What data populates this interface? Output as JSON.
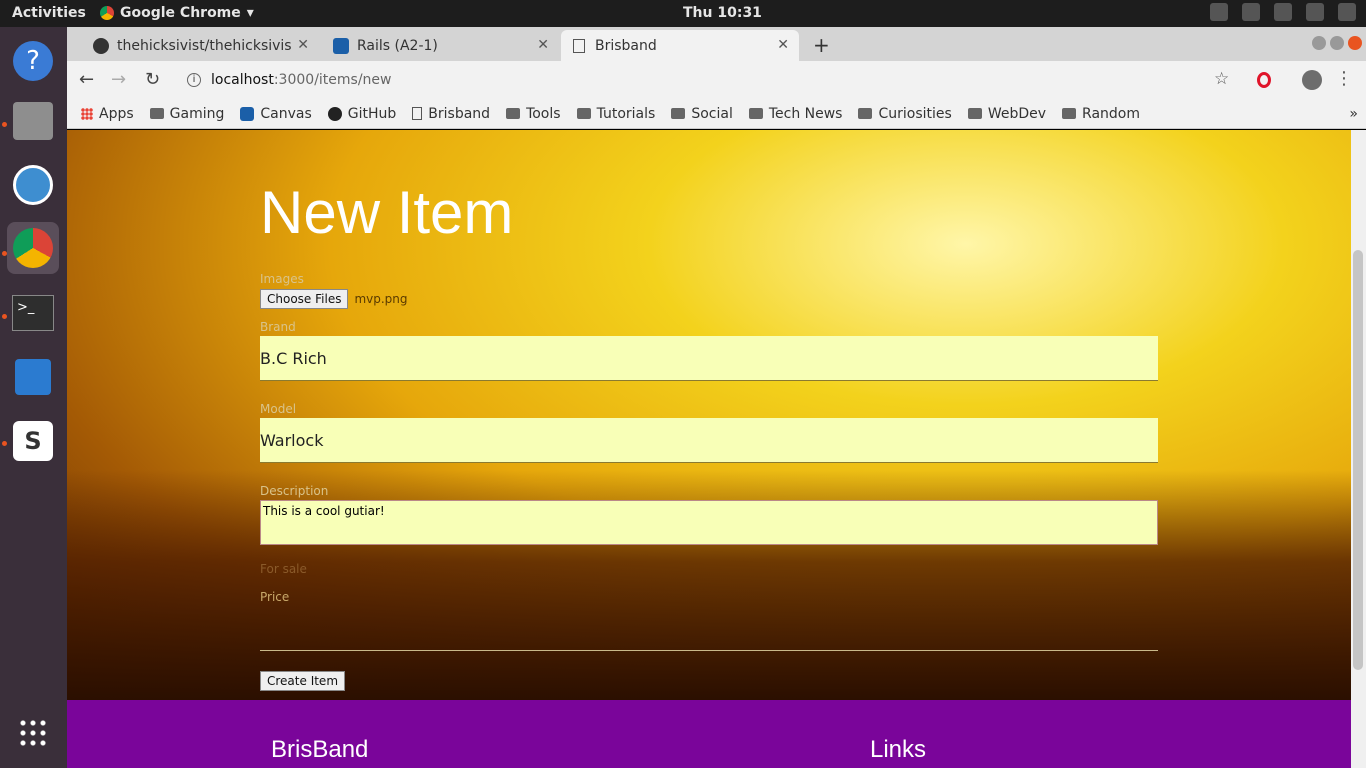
{
  "system": {
    "activities": "Activities",
    "app_name": "Google Chrome",
    "clock": "Thu 10:31"
  },
  "tabs": [
    {
      "label": "thehicksivist/thehicksivis"
    },
    {
      "label": "Rails (A2-1)"
    },
    {
      "label": "Brisband"
    }
  ],
  "address": {
    "host": "localhost",
    "path": ":3000/items/new"
  },
  "bookmarks": [
    "Apps",
    "Gaming",
    "Canvas",
    "GitHub",
    "Brisband",
    "Tools",
    "Tutorials",
    "Social",
    "Tech News",
    "Curiosities",
    "WebDev",
    "Random"
  ],
  "page": {
    "title": "New Item",
    "images_label": "Images",
    "choose_files": "Choose Files",
    "file_name": "mvp.png",
    "brand_label": "Brand",
    "brand_value": "B.C Rich",
    "model_label": "Model",
    "model_value": "Warlock",
    "description_label": "Description",
    "description_value": "This is a cool gutiar!",
    "for_sale_label": "For sale",
    "price_label": "Price",
    "submit": "Create Item"
  },
  "footer": {
    "brand": "BrisBand",
    "links": "Links"
  }
}
